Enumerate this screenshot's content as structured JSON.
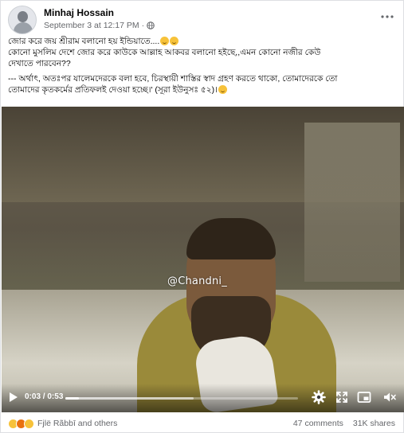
{
  "post": {
    "author": "Minhaj Hossain",
    "timestamp": "September 3 at 12:17 PM",
    "separator": "·",
    "privacy_icon": "globe-icon",
    "more_icon": "more-options-icon",
    "text_lines": [
      "জোর করে জয় শ্রীরাম বলানো হয় ইন্ডিয়াতে....",
      "কোনো মুসলিম দেশে জোর করে কাউকে আল্লাহ আকবর বলানো হইছে,,এমন কোনো নজীর কেউ",
      "দেখাতে পারবেন??",
      "--- অর্থাৎ, অতঃপর যালেমদেরকে বলা হবে, চিরস্থায়ী শাস্তির স্বাদ গ্রহণ করতে থাকো, তোমাদেরকে তো",
      "তোমাদের কৃতকর্মের প্রতিফলই দেওয়া হচ্ছে।' (সূরা ইউনুসঃ ৫২)।"
    ]
  },
  "video": {
    "watermark": "@Chandni_",
    "current_time": "0:03",
    "time_separator": " / ",
    "duration": "0:53",
    "played_fraction": 0.057,
    "buffered_fraction": 0.55,
    "controls": [
      "play-icon",
      "settings-icon",
      "fullscreen-icon",
      "picture-in-picture-icon",
      "volume-icon"
    ]
  },
  "footer": {
    "reaction_icons": [
      "haha-icon",
      "angry-icon",
      "sad-icon"
    ],
    "reactors": "Fjlë Rãbbī and others",
    "comments": "47 comments",
    "shares": "31K shares"
  },
  "colors": {
    "text_primary": "#050505",
    "text_secondary": "#65676b",
    "background": "#ffffff"
  }
}
